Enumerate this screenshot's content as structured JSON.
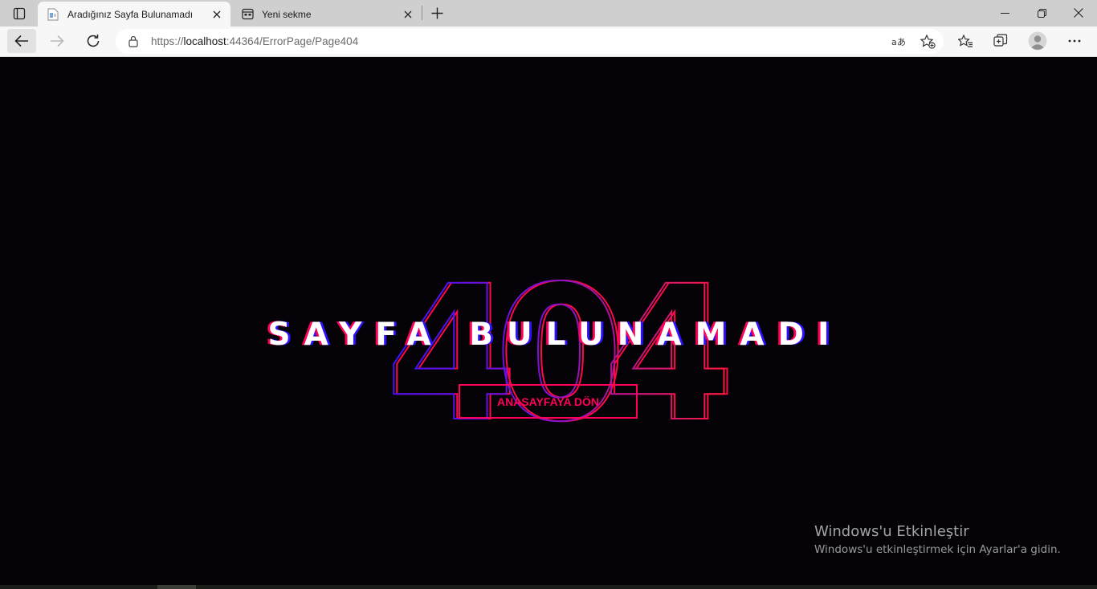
{
  "browser": {
    "tabs": [
      {
        "title": "Aradığınız Sayfa Bulunamadı",
        "active": true
      },
      {
        "title": "Yeni sekme",
        "active": false
      }
    ],
    "url_scheme": "https://",
    "url_host": "localhost",
    "url_rest": ":44364/ErrorPage/Page404"
  },
  "page": {
    "code": "404",
    "headline": "SAYFA BULUNAMADI",
    "home_button": "ANASAYFAYA DÖN",
    "colors": {
      "background": "#050308",
      "accent_pink": "#ff005a",
      "accent_blue": "#2d11ff"
    }
  },
  "watermark": {
    "title": "Windows'u Etkinleştir",
    "subtitle": "Windows'u etkinleştirmek için Ayarlar'a gidin."
  }
}
